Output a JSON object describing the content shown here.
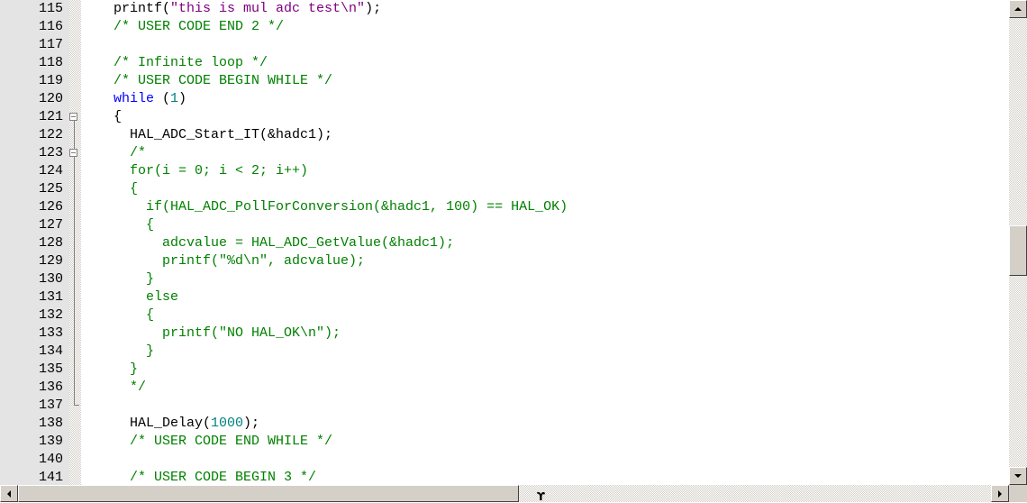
{
  "editor": {
    "colors": {
      "default": "#000000",
      "keyword": "#0000ff",
      "string": "#800080",
      "number": "#008080",
      "comment": "#008000",
      "gutter_bg": "#e4e4e4",
      "scrollbar_face": "#d4d0c8"
    },
    "fold_markers": [
      {
        "line": 121,
        "state": "expanded",
        "icon": "minus-box-icon"
      },
      {
        "line": 123,
        "state": "expanded",
        "icon": "minus-box-icon"
      }
    ],
    "lines": [
      {
        "n": "115",
        "tokens": [
          {
            "t": "  printf(",
            "k": "default"
          },
          {
            "t": "\"this is mul adc test\\n\"",
            "k": "string"
          },
          {
            "t": ");",
            "k": "default"
          }
        ]
      },
      {
        "n": "116",
        "tokens": [
          {
            "t": "  /* USER CODE END 2 */",
            "k": "comment"
          }
        ]
      },
      {
        "n": "117",
        "tokens": []
      },
      {
        "n": "118",
        "tokens": [
          {
            "t": "  /* Infinite loop */",
            "k": "comment"
          }
        ]
      },
      {
        "n": "119",
        "tokens": [
          {
            "t": "  /* USER CODE BEGIN WHILE */",
            "k": "comment"
          }
        ]
      },
      {
        "n": "120",
        "tokens": [
          {
            "t": "  while",
            "k": "keyword"
          },
          {
            "t": " (",
            "k": "default"
          },
          {
            "t": "1",
            "k": "number"
          },
          {
            "t": ")",
            "k": "default"
          }
        ]
      },
      {
        "n": "121",
        "tokens": [
          {
            "t": "  {",
            "k": "default"
          }
        ]
      },
      {
        "n": "122",
        "tokens": [
          {
            "t": "    HAL_ADC_Start_IT(&hadc1);",
            "k": "default"
          }
        ]
      },
      {
        "n": "123",
        "tokens": [
          {
            "t": "    /*",
            "k": "comment"
          }
        ]
      },
      {
        "n": "124",
        "tokens": [
          {
            "t": "    for(i = 0; i < 2; i++)",
            "k": "comment"
          }
        ]
      },
      {
        "n": "125",
        "tokens": [
          {
            "t": "    {",
            "k": "comment"
          }
        ]
      },
      {
        "n": "126",
        "tokens": [
          {
            "t": "      if(HAL_ADC_PollForConversion(&hadc1, 100) == HAL_OK)",
            "k": "comment"
          }
        ]
      },
      {
        "n": "127",
        "tokens": [
          {
            "t": "      {",
            "k": "comment"
          }
        ]
      },
      {
        "n": "128",
        "tokens": [
          {
            "t": "        adcvalue = HAL_ADC_GetValue(&hadc1);",
            "k": "comment"
          }
        ]
      },
      {
        "n": "129",
        "tokens": [
          {
            "t": "        printf(\"%d\\n\", adcvalue);",
            "k": "comment"
          }
        ]
      },
      {
        "n": "130",
        "tokens": [
          {
            "t": "      }",
            "k": "comment"
          }
        ]
      },
      {
        "n": "131",
        "tokens": [
          {
            "t": "      else",
            "k": "comment"
          }
        ]
      },
      {
        "n": "132",
        "tokens": [
          {
            "t": "      {",
            "k": "comment"
          }
        ]
      },
      {
        "n": "133",
        "tokens": [
          {
            "t": "        printf(\"NO HAL_OK\\n\");",
            "k": "comment"
          }
        ]
      },
      {
        "n": "134",
        "tokens": [
          {
            "t": "      }",
            "k": "comment"
          }
        ]
      },
      {
        "n": "135",
        "tokens": [
          {
            "t": "    }",
            "k": "comment"
          }
        ]
      },
      {
        "n": "136",
        "tokens": [
          {
            "t": "    */",
            "k": "comment"
          }
        ]
      },
      {
        "n": "137",
        "tokens": []
      },
      {
        "n": "138",
        "tokens": [
          {
            "t": "    HAL_Delay(",
            "k": "default"
          },
          {
            "t": "1000",
            "k": "number"
          },
          {
            "t": ");",
            "k": "default"
          }
        ]
      },
      {
        "n": "139",
        "tokens": [
          {
            "t": "    /* USER CODE END WHILE */",
            "k": "comment"
          }
        ]
      },
      {
        "n": "140",
        "tokens": []
      },
      {
        "n": "141",
        "tokens": [
          {
            "t": "    /* USER CODE BEGIN 3 */",
            "k": "comment"
          }
        ]
      }
    ]
  },
  "scrollbars": {
    "vertical": {
      "position_fraction": 0.52,
      "up_icon": "arrow-up-icon",
      "down_icon": "arrow-down-icon"
    },
    "horizontal": {
      "position_fraction": 0.0,
      "left_icon": "arrow-left-icon",
      "right_icon": "arrow-right-icon"
    }
  },
  "mouse_cursor": {
    "glyph": "ϒ",
    "icon": "text-cursor-icon"
  }
}
